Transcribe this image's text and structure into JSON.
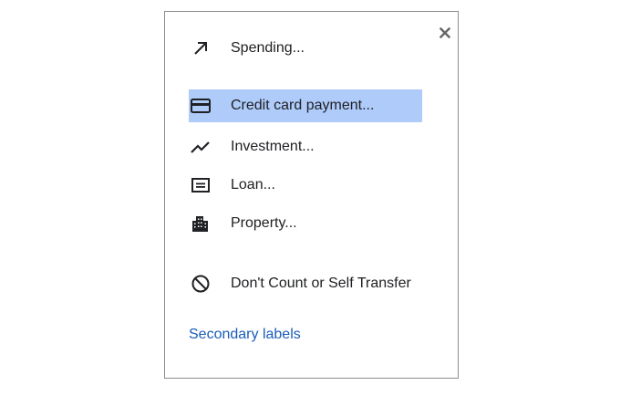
{
  "menu": {
    "close_icon": "close-icon",
    "items": [
      {
        "id": "spending",
        "icon": "arrow-up-right-icon",
        "label": "Spending...",
        "selected": false
      },
      {
        "id": "credit-card-payment",
        "icon": "credit-card-icon",
        "label": "Credit card payment...",
        "selected": true
      },
      {
        "id": "investment",
        "icon": "trending-line-icon",
        "label": "Investment...",
        "selected": false
      },
      {
        "id": "loan",
        "icon": "document-icon",
        "label": "Loan...",
        "selected": false
      },
      {
        "id": "property",
        "icon": "building-icon",
        "label": "Property...",
        "selected": false
      },
      {
        "id": "dont-count",
        "icon": "block-icon",
        "label": "Don't Count or Self Transfer",
        "selected": false
      }
    ],
    "secondary_link": "Secondary labels"
  },
  "colors": {
    "selected_bg": "#aecbfa",
    "link": "#1a5cb8",
    "border": "#8c8c8c"
  }
}
